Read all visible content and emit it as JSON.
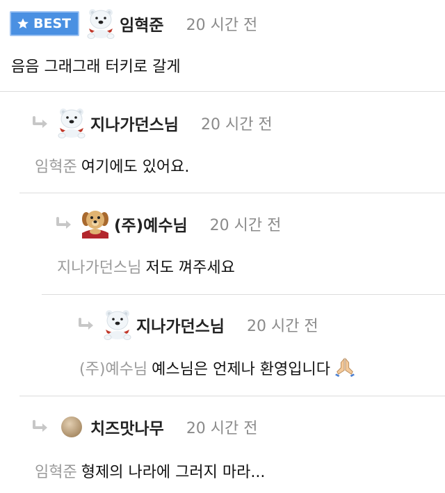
{
  "best_badge_label": "BEST",
  "comments": [
    {
      "author": "임혁준",
      "time": "20 시간 전",
      "mention": "",
      "text": "음음 그래그래 터키로 갈게",
      "avatar_icon": "polar-bear-icon"
    },
    {
      "author": "지나가던스님",
      "time": "20 시간 전",
      "mention": "임혁준",
      "text": "여기에도 있어요.",
      "avatar_icon": "polar-bear-icon"
    },
    {
      "author": "(주)예수님",
      "time": "20 시간 전",
      "mention": "지나가던스님",
      "text": "저도 껴주세요",
      "avatar_icon": "puppy-icon"
    },
    {
      "author": "지나가던스님",
      "time": "20 시간 전",
      "mention": "(주)예수님",
      "text": "예스님은 언제나 환영입니다",
      "avatar_icon": "polar-bear-icon",
      "trailing_icon": "praying-hands-icon"
    },
    {
      "author": "치즈맛나무",
      "time": "20 시간 전",
      "mention": "임혁준",
      "text": "형제의 나라에 그러지 마라...",
      "avatar_icon": "round-avatar-icon"
    }
  ],
  "colors": {
    "badge": "#4a90e2",
    "meta_gray": "#8a8a8a",
    "mention_gray": "#9a9a9a",
    "divider": "#dcdcdc"
  }
}
